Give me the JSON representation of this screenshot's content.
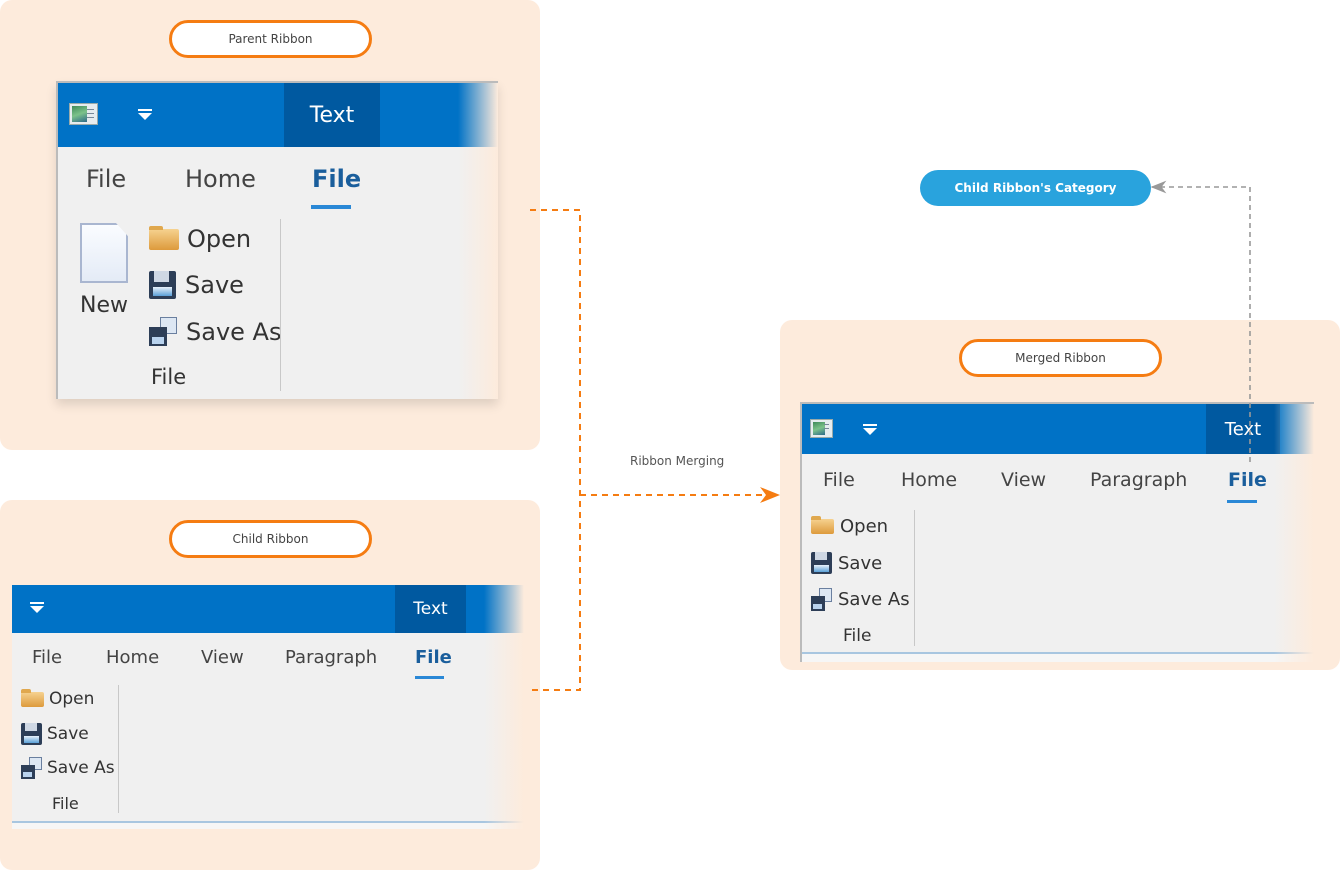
{
  "colors": {
    "panel_bg": "#fdebdc",
    "pill_border": "#f57c12",
    "titlebar": "#0072c6",
    "contextual_tab": "#0059a0",
    "active_tab_text": "#1a5e9c",
    "active_tab_underline": "#2a88d6",
    "callout_bg": "#29a3dd",
    "merge_arrow": "#f57c12",
    "category_arrow": "#999999"
  },
  "parent": {
    "label": "Parent Ribbon",
    "contextual_tab": "Text",
    "tabs": [
      "File",
      "Home",
      "File"
    ],
    "active_tab_index": 2,
    "group": {
      "large_button": {
        "label": "New",
        "icon": "new-document-icon"
      },
      "items": [
        {
          "label": "Open",
          "icon": "open-folder-icon"
        },
        {
          "label": "Save",
          "icon": "save-disk-icon"
        },
        {
          "label": "Save As",
          "icon": "save-as-icon"
        }
      ],
      "label": "File"
    }
  },
  "child": {
    "label": "Child Ribbon",
    "contextual_tab": "Text",
    "tabs": [
      "File",
      "Home",
      "View",
      "Paragraph",
      "File"
    ],
    "active_tab_index": 4,
    "group": {
      "items": [
        {
          "label": "Open",
          "icon": "open-folder-icon"
        },
        {
          "label": "Save",
          "icon": "save-disk-icon"
        },
        {
          "label": "Save As",
          "icon": "save-as-icon"
        }
      ],
      "label": "File"
    }
  },
  "merged": {
    "label": "Merged Ribbon",
    "contextual_tab": "Text",
    "tabs": [
      "File",
      "Home",
      "View",
      "Paragraph",
      "File"
    ],
    "active_tab_index": 4,
    "group": {
      "items": [
        {
          "label": "Open",
          "icon": "open-folder-icon"
        },
        {
          "label": "Save",
          "icon": "save-disk-icon"
        },
        {
          "label": "Save As",
          "icon": "save-as-icon"
        }
      ],
      "label": "File"
    }
  },
  "annotations": {
    "merge_caption": "Ribbon Merging",
    "category_callout": "Child Ribbon's Category"
  }
}
